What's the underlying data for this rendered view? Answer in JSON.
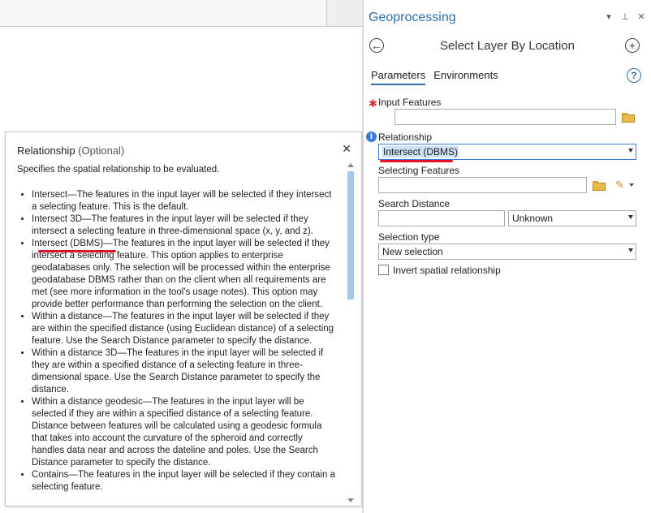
{
  "geoprocessing": {
    "pane_title": "Geoprocessing",
    "tool_title": "Select Layer By Location",
    "tabs": [
      {
        "label": "Parameters",
        "active": true
      },
      {
        "label": "Environments",
        "active": false
      }
    ],
    "params": {
      "input_features": {
        "label": "Input Features",
        "value": ""
      },
      "relationship": {
        "label": "Relationship",
        "value": "Intersect (DBMS)"
      },
      "selecting_features": {
        "label": "Selecting Features",
        "value": ""
      },
      "search_distance": {
        "label": "Search Distance",
        "value": "",
        "unit": "Unknown"
      },
      "selection_type": {
        "label": "Selection type",
        "value": "New selection"
      },
      "invert": {
        "label": "Invert spatial relationship",
        "checked": false
      }
    }
  },
  "help_popup": {
    "title": "Relationship",
    "optional": "(Optional)",
    "description": "Specifies the spatial relationship to be evaluated.",
    "items": [
      "Intersect—The features in the input layer will be selected if they intersect a selecting feature. This is the default.",
      "Intersect 3D—The features in the input layer will be selected if they intersect a selecting feature in three-dimensional space (x, y, and z).",
      "Intersect (DBMS)—The features in the input layer will be selected if they intersect a selecting feature. This option applies to enterprise geodatabases only. The selection will be processed within the enterprise geodatabase DBMS rather than on the client when all requirements are met (see more information in the tool's usage notes). This option may provide better performance than performing the selection on the client.",
      "Within a distance—The features in the input layer will be selected if they are within the specified distance (using Euclidean distance) of a selecting feature. Use the Search Distance parameter to specify the distance.",
      "Within a distance 3D—The features in the input layer will be selected if they are within a specified distance of a selecting feature in three-dimensional space. Use the Search Distance parameter to specify the distance.",
      "Within a distance geodesic—The features in the input layer will be selected if they are within a specified distance of a selecting feature. Distance between features will be calculated using a geodesic formula that takes into account the curvature of the spheroid and correctly handles data near and across the dateline and poles. Use the Search Distance parameter to specify the distance.",
      "Contains—The features in the input layer will be selected if they contain a selecting feature."
    ]
  },
  "colors": {
    "accent": "#2f6dae",
    "required_star": "#d03030",
    "annotation_underline": "#e0102a",
    "selection_highlight": "#cce0f7"
  }
}
